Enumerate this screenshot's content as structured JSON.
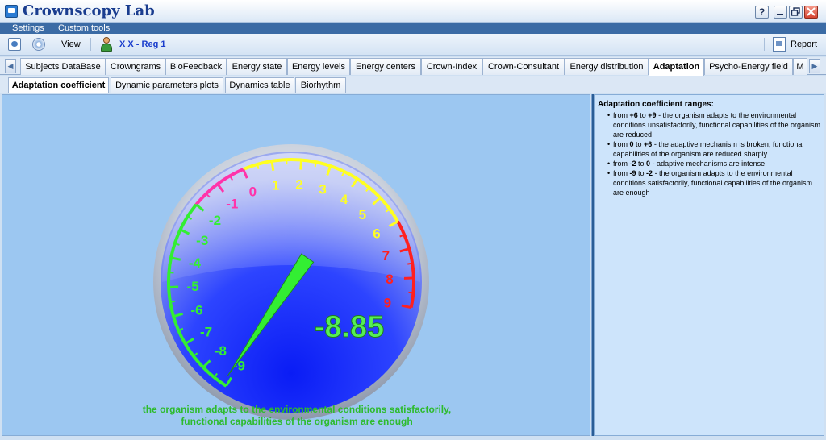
{
  "window": {
    "title": "Crownscopy Lab",
    "help_label": "?",
    "icon": "app-icon"
  },
  "menu": {
    "items": [
      "Settings",
      "Custom tools"
    ]
  },
  "toolbar": {
    "view_label": "View",
    "user_label": "X X  - Reg 1",
    "report_label": "Report"
  },
  "tabs": [
    "Subjects DataBase",
    "Crowngrams",
    "BioFeedback",
    "Energy state",
    "Energy levels",
    "Energy centers",
    "Crown-Index",
    "Crown-Consultant",
    "Energy distribution",
    "Adaptation",
    "Psycho-Energy field",
    "M"
  ],
  "active_tab": "Adaptation",
  "subtabs": [
    "Adaptation coefficient",
    "Dynamic parameters plots",
    "Dynamics table",
    "Biorhythm"
  ],
  "active_subtab": "Adaptation coefficient",
  "gauge": {
    "value": -8.85,
    "value_label": "-8.85",
    "min": -9,
    "max": 9,
    "ticks": [
      "-9",
      "-8",
      "-7",
      "-6",
      "-5",
      "-4",
      "-3",
      "-2",
      "-1",
      "0",
      "1",
      "2",
      "3",
      "4",
      "5",
      "6",
      "7",
      "8",
      "9"
    ],
    "ranges": [
      {
        "from": -9,
        "to": -2,
        "color": "#33ee33"
      },
      {
        "from": -2,
        "to": 0,
        "color": "#ff33aa"
      },
      {
        "from": 0,
        "to": 6,
        "color": "#ffff22"
      },
      {
        "from": 6,
        "to": 9,
        "color": "#ff2020"
      }
    ],
    "needle_color": "#33ee33"
  },
  "status": {
    "line1": "the organism adapts to the environmental conditions satisfactorily,",
    "line2": "functional capabilities of the organism are enough"
  },
  "info": {
    "title": "Adaptation coefficient ranges:",
    "items": [
      {
        "from": "+6",
        "to": "+9",
        "text": " - the organism adapts to the environmental conditions unsatisfactorily, functional capabilities of the organism are reduced"
      },
      {
        "from": "0",
        "to": "+6",
        "text": " - the adaptive mechanism is broken, functional capabilities of the organism are reduced sharply"
      },
      {
        "from": "-2",
        "to": "0",
        "text": " - adaptive mechanisms are intense"
      },
      {
        "from": "-9",
        "to": "-2",
        "text": " - the organism adapts to the environmental conditions satisfactorily, functional capabilities of the organism are enough"
      }
    ],
    "from_word": "from ",
    "to_word": " to "
  }
}
